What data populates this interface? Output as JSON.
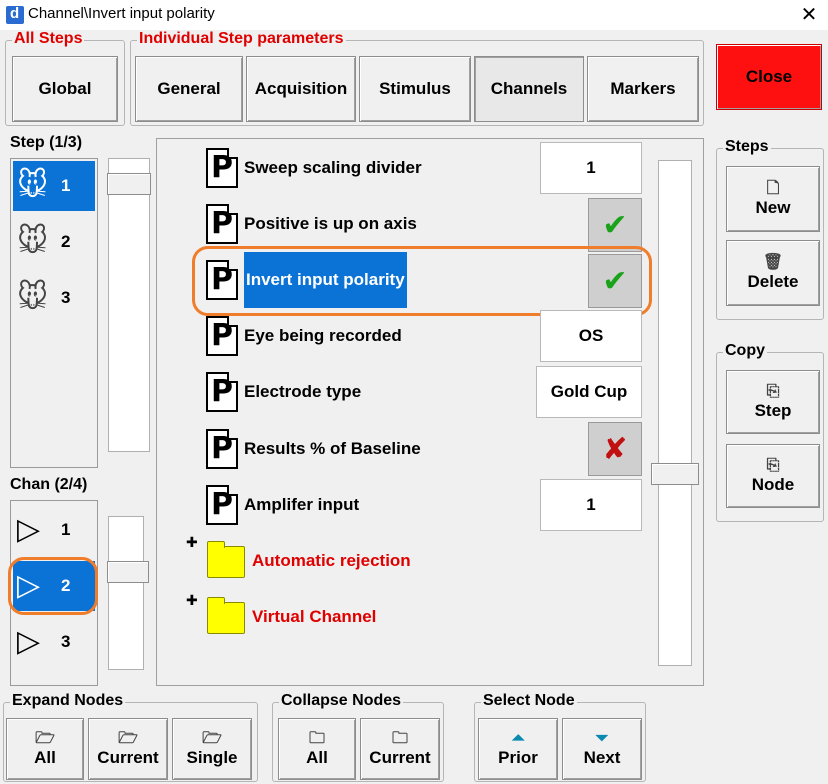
{
  "window": {
    "title": "Channel\\Invert input polarity"
  },
  "groups": {
    "all_steps": "All Steps",
    "individual": "Individual Step parameters",
    "steps": "Steps",
    "copy": "Copy",
    "expand": "Expand Nodes",
    "collapse": "Collapse Nodes",
    "select": "Select Node"
  },
  "tabs": {
    "global": "Global",
    "general": "General",
    "acquisition": "Acquisition",
    "stimulus": "Stimulus",
    "channels": "Channels",
    "markers": "Markers"
  },
  "close_label": "Close",
  "step_list": {
    "header": "Step (1/3)",
    "items": [
      "1",
      "2",
      "3"
    ],
    "selected": "1"
  },
  "chan_list": {
    "header": "Chan (2/4)",
    "items": [
      "1",
      "2",
      "3"
    ],
    "selected": "2"
  },
  "params": [
    {
      "label": "Sweep scaling divider",
      "value": "1",
      "kind": "text"
    },
    {
      "label": "Positive is up on axis",
      "value": "checked",
      "kind": "check"
    },
    {
      "label": "Invert input polarity",
      "value": "checked",
      "kind": "check",
      "selected": true
    },
    {
      "label": "Eye being recorded",
      "value": "OS",
      "kind": "text"
    },
    {
      "label": "Electrode type",
      "value": "Gold Cup",
      "kind": "text"
    },
    {
      "label": "Results % of Baseline",
      "value": "unchecked",
      "kind": "check"
    },
    {
      "label": "Amplifer input",
      "value": "1",
      "kind": "text"
    }
  ],
  "nodes": [
    {
      "label": "Automatic rejection",
      "color": "#e00000"
    },
    {
      "label": "Virtual Channel",
      "color": "#e00000"
    }
  ],
  "steps_buttons": {
    "new": "New",
    "delete": "Delete"
  },
  "copy_buttons": {
    "step": "Step",
    "node": "Node"
  },
  "expand_buttons": {
    "all": "All",
    "current": "Current",
    "single": "Single"
  },
  "collapse_buttons": {
    "all": "All",
    "current": "Current"
  },
  "select_buttons": {
    "prior": "Prior",
    "next": "Next"
  },
  "colors": {
    "selection": "#0b72d6",
    "highlight": "#ef7d2b",
    "close_bg": "#ff1010",
    "folder": "#ffff00"
  }
}
